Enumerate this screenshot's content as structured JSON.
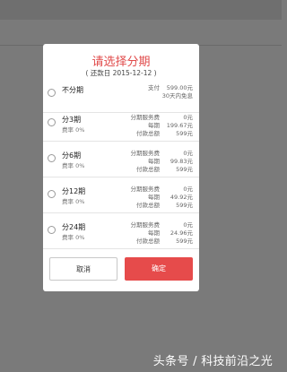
{
  "dialog": {
    "title": "请选择分期",
    "repay_date": "( 还款日 2015-12-12 )",
    "cancel_label": "取消",
    "confirm_label": "确定"
  },
  "no_installment": {
    "name": "不分期",
    "pay_label": "支付",
    "pay_value": "599.00元",
    "note": "30天内免息"
  },
  "labels": {
    "fee": "分期服务费",
    "per": "每期",
    "total": "付款总额"
  },
  "options": [
    {
      "name": "分3期",
      "rate": "费率 0%",
      "fee": "0元",
      "per": "199.67元",
      "total": "599元"
    },
    {
      "name": "分6期",
      "rate": "费率 0%",
      "fee": "0元",
      "per": "99.83元",
      "total": "599元"
    },
    {
      "name": "分12期",
      "rate": "费率 0%",
      "fee": "0元",
      "per": "49.92元",
      "total": "599元"
    },
    {
      "name": "分24期",
      "rate": "费率 0%",
      "fee": "0元",
      "per": "24.96元",
      "total": "599元"
    }
  ],
  "watermark": "头条号 / 科技前沿之光",
  "colors": {
    "accent": "#e64b4b",
    "title": "#e04a4a",
    "overlay": "#7a7a7a"
  }
}
